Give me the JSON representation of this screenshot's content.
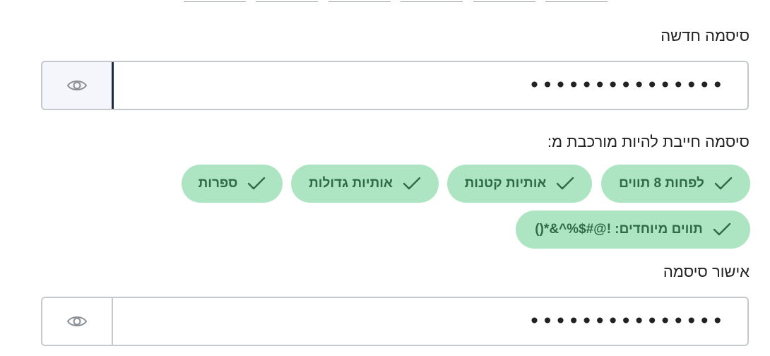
{
  "new_password": {
    "label": "סיסמה חדשה",
    "value": "•••••••••••••••",
    "toggle_icon": "eye-icon"
  },
  "requirements": {
    "heading": "סיסמה חייבת להיות מורכבת מ:",
    "check_icon": "checkmark-icon",
    "status_color": "#ade5c2",
    "items": [
      {
        "label": "לפחות 8 תווים",
        "met": true
      },
      {
        "label": "אותיות קטנות",
        "met": true
      },
      {
        "label": "אותיות גדולות",
        "met": true
      },
      {
        "label": "ספרות",
        "met": true
      },
      {
        "label": "תווים מיוחדים: !@#$%^&*()",
        "met": true
      }
    ]
  },
  "confirm_password": {
    "label": "אישור סיסמה",
    "value": "•••••••••••••••",
    "toggle_icon": "eye-icon"
  }
}
